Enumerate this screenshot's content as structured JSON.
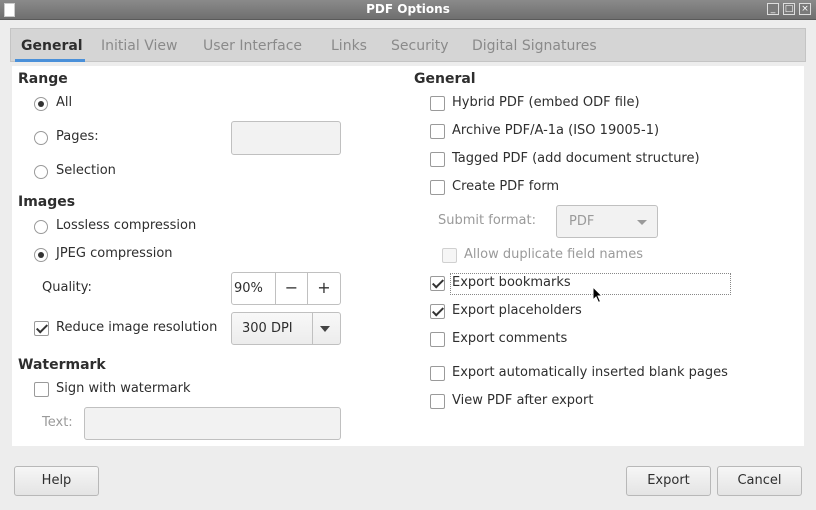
{
  "window": {
    "title": "PDF Options"
  },
  "tabs": [
    {
      "label": "General"
    },
    {
      "label": "Initial View"
    },
    {
      "label": "User Interface"
    },
    {
      "label": "Links"
    },
    {
      "label": "Security"
    },
    {
      "label": "Digital Signatures"
    }
  ],
  "range": {
    "title": "Range",
    "all": "All",
    "pages": "Pages:",
    "pages_value": "",
    "selection": "Selection",
    "selected": "all"
  },
  "images": {
    "title": "Images",
    "lossless": "Lossless compression",
    "jpeg": "JPEG compression",
    "selected": "jpeg",
    "quality_label": "Quality:",
    "quality_value": "90%",
    "minus": "−",
    "plus": "+",
    "reduce_label": "Reduce image resolution",
    "reduce_checked": true,
    "resolution_value": "300 DPI"
  },
  "watermark": {
    "title": "Watermark",
    "sign_label": "Sign with watermark",
    "sign_checked": false,
    "text_label": "Text:",
    "text_value": ""
  },
  "general": {
    "title": "General",
    "hybrid": "Hybrid PDF (embed ODF file)",
    "archive": "Archive PDF/A-1a (ISO 19005-1)",
    "tagged": "Tagged PDF (add document structure)",
    "create_form": "Create PDF form",
    "submit_label": "Submit format:",
    "submit_value": "PDF",
    "allow_duplicate": "Allow duplicate field names",
    "export_bookmarks": "Export bookmarks",
    "export_placeholders": "Export placeholders",
    "export_comments": "Export comments",
    "export_blank": "Export automatically inserted blank pages",
    "view_after": "View PDF after export"
  },
  "footer": {
    "help": "Help",
    "export": "Export",
    "cancel": "Cancel"
  }
}
